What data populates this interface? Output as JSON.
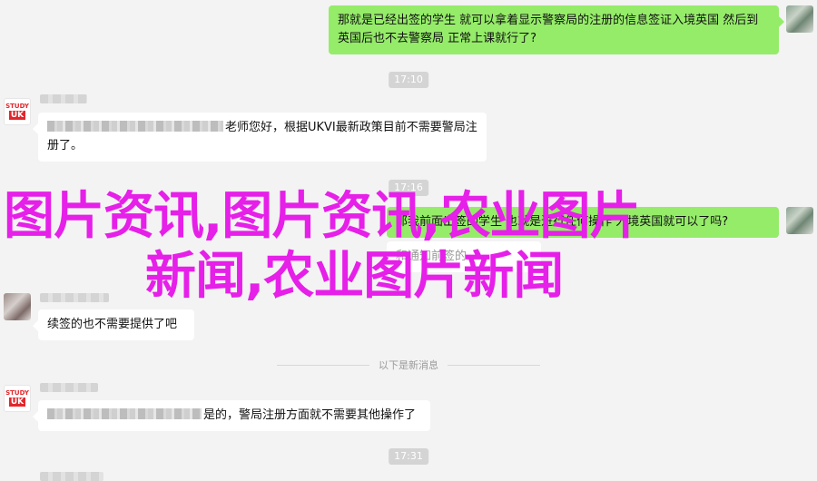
{
  "messages": [
    {
      "side": "out",
      "text": "那就是已经出签的学生 就可以拿着显示警察局的注册的信息签证入境英国 然后到英国后也不去警察局 正常上课就行了?"
    },
    {
      "side": "in",
      "text_tail": "老师您好，根据UKVI最新政策目前不需要警局注册了。"
    },
    {
      "side": "out",
      "text": "那我前面出签的学生 也就是进行任何操作 入境英国就可以了吗?"
    },
    {
      "side": "out",
      "text_fragment": "和通知前签的"
    },
    {
      "side": "in",
      "text": "续签的也不需要提供了吧"
    },
    {
      "side": "in",
      "text_tail": "是的，警局注册方面就不需要其他操作了"
    }
  ],
  "times": [
    "17:10",
    "17:16",
    "17:31"
  ],
  "divider": "以下是新消息",
  "avatars": {
    "agency_line1": "STUDY",
    "agency_line2": "UK"
  },
  "overlay": {
    "line1": "图片资讯,图片资讯,农业图片",
    "line2": "新闻,农业图片新闻"
  },
  "colors": {
    "out_bubble": "#95ec69",
    "in_bubble": "#ffffff",
    "overlay": "#e61fe9",
    "background": "#f3f3f3"
  }
}
